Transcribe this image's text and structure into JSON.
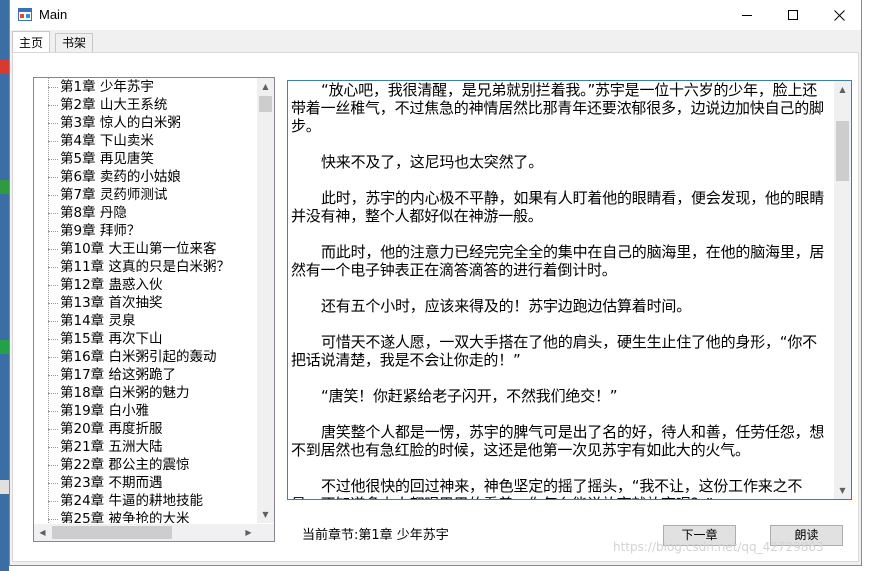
{
  "window": {
    "title": "Main"
  },
  "tabs": [
    {
      "label": "主页",
      "active": true
    },
    {
      "label": "书架",
      "active": false
    }
  ],
  "chapters": [
    "第1章 少年苏宇",
    "第2章 山大王系统",
    "第3章 惊人的白米粥",
    "第4章 下山卖米",
    "第5章 再见唐笑",
    "第6章 卖药的小姑娘",
    "第7章 灵药师测试",
    "第8章 丹隐",
    "第9章 拜师？",
    "第10章 大王山第一位来客",
    "第11章 这真的只是白米粥？",
    "第12章 蛊惑入伙",
    "第13章 首次抽奖",
    "第14章 灵泉",
    "第15章 再次下山",
    "第16章 白米粥引起的轰动",
    "第17章 给这粥跪了",
    "第18章 白米粥的魅力",
    "第19章 白小雅",
    "第20章 再度折服",
    "第21章 五洲大陆",
    "第22章 郡公主的震惊",
    "第23章 不期而遇",
    "第24章 牛逼的耕地技能",
    "第25章 被争抢的大米"
  ],
  "content": {
    "paragraphs": [
      "“放心吧，我很清醒，是兄弟就别拦着我。”苏宇是一位十六岁的少年，脸上还带着一丝稚气，不过焦急的神情居然比那青年还要浓郁很多，边说边加快自己的脚步。",
      "快来不及了，这尼玛也太突然了。",
      "此时，苏宇的内心极不平静，如果有人盯着他的眼睛看，便会发现，他的眼睛并没有神，整个人都好似在神游一般。",
      "而此时，他的注意力已经完完全全的集中在自己的脑海里，在他的脑海里，居然有一个电子钟表正在滴答滴答的进行着倒计时。",
      "还有五个小时，应该来得及的！苏宇边跑边估算着时间。",
      "可惜天不遂人愿，一双大手搭在了他的肩头，硬生生止住了他的身形，“你不把话说清楚，我是不会让你走的！”",
      "“唐笑！你赶紧给老子闪开，不然我们绝交！”",
      "唐笑整个人都是一愣，苏宇的脾气可是出了名的好，待人和善，任劳任怨，想不到居然也有急红脸的时候，这还是他第一次见苏宇有如此大的火气。",
      "不过他很快的回过神来，神色坚定的摇了摇头，“我不让，这份工作来之不易，不知道多少人都眼巴巴的看着，你怎么能说放弃就放弃呢？”"
    ]
  },
  "status": {
    "label": "当前章节:",
    "chapter": "第1章 少年苏宇"
  },
  "buttons": {
    "next": "下一章",
    "read": "朗读"
  },
  "watermark": "https://blog.csdn.net/qq_42729863",
  "colors": {
    "accent_border": "#3c7fb1",
    "window_bg": "#f0f0f0",
    "desktop": "#3a6ea5"
  }
}
